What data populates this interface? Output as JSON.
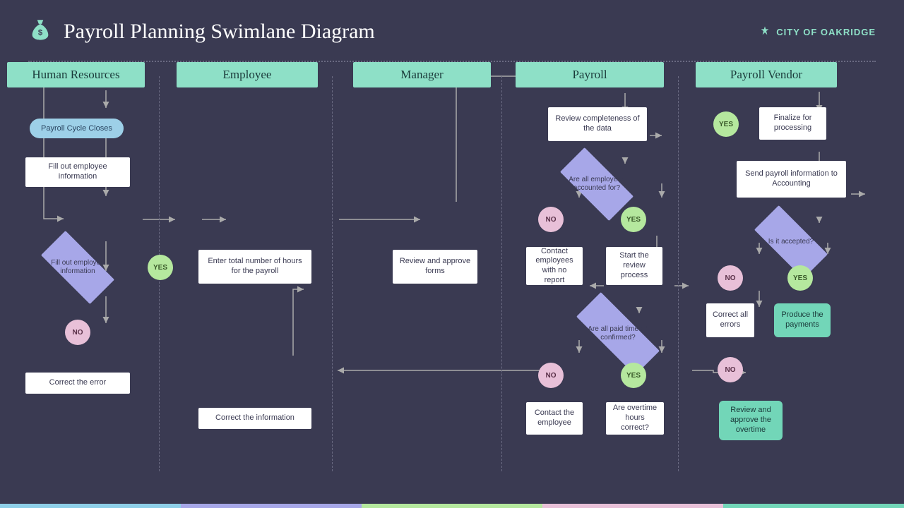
{
  "header": {
    "title": "Payroll Planning Swimlane Diagram",
    "city": "CITY OF OAKRIDGE"
  },
  "lanes": {
    "hr": "Human Resources",
    "employee": "Employee",
    "manager": "Manager",
    "payroll": "Payroll",
    "vendor": "Payroll Vendor"
  },
  "nodes": {
    "hr_start": "Payroll Cycle Closes",
    "hr_fill": "Fill out employee information",
    "hr_decision": "Fill out employee information",
    "hr_no": "NO",
    "hr_yes": "YES",
    "hr_correct": "Correct the error",
    "emp_hours": "Enter total number of hours for the payroll",
    "mgr_review": "Review and approve forms",
    "pay_review": "Review completeness of the data",
    "pay_d1": "Are all employees accounted for?",
    "pay_d1_no": "NO",
    "pay_d1_yes": "YES",
    "pay_contact": "Contact employees with no report",
    "pay_start": "Start the review process",
    "pay_d2": "Are all paid time off confirmed?",
    "pay_d2_no": "NO",
    "pay_d2_yes": "YES",
    "pay_contact2": "Contact the employee",
    "pay_overtime": "Are overtime hours correct?",
    "emp_correct": "Correct the information",
    "ven_yes": "YES",
    "ven_finalize": "Finalize for processing",
    "ven_send": "Send payroll information to Accounting",
    "ven_d1": "Is it accepted?",
    "ven_d1_no": "NO",
    "ven_d1_yes": "YES",
    "ven_correct": "Correct all errors",
    "ven_produce": "Produce the payments",
    "ven_no2": "NO",
    "ven_review_ot": "Review  and approve the overtime"
  }
}
